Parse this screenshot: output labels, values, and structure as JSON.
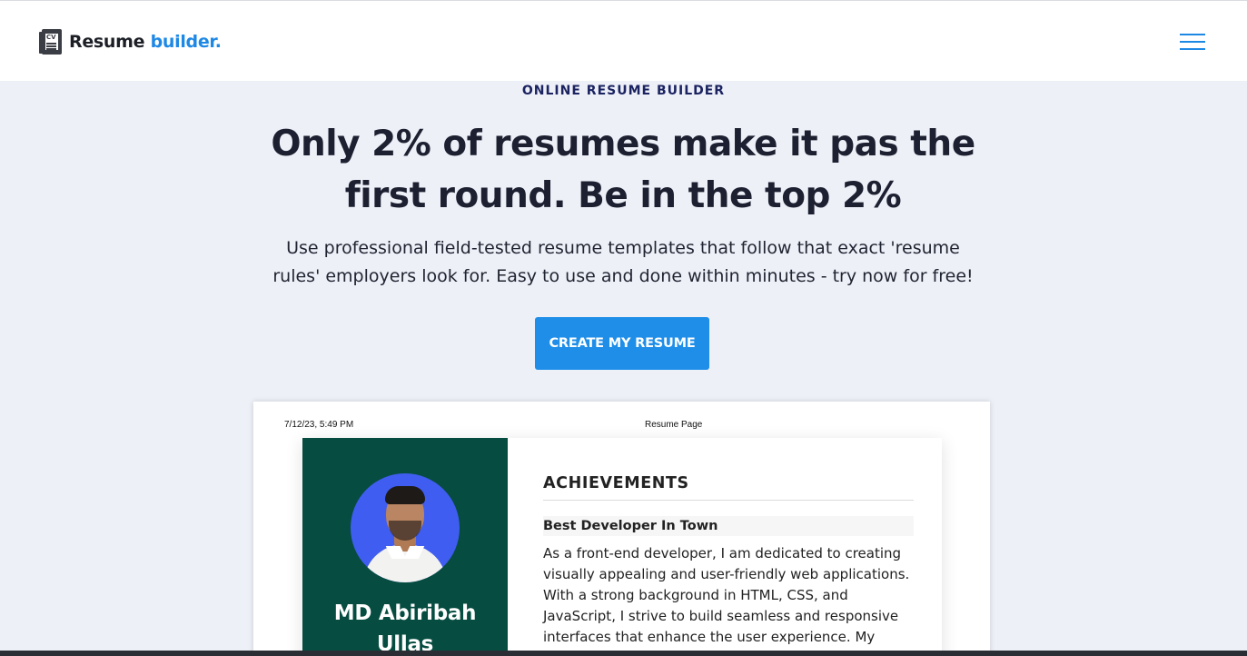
{
  "header": {
    "brand_main": "Resume",
    "brand_accent": "builder.",
    "logo_icon": "cv-document-icon",
    "menu_icon": "hamburger-menu-icon"
  },
  "hero": {
    "eyebrow": "ONLINE RESUME BUILDER",
    "headline_line1": "Only 2% of resumes make it pas the",
    "headline_line2": "first round. Be in the top 2%",
    "subtext_line1": "Use professional field-tested resume templates that follow that exact 'resume",
    "subtext_line2": "rules' employers look for. Easy to use and done within minutes - try now for free!",
    "cta_label": "CREATE MY RESUME"
  },
  "preview": {
    "print_date": "7/12/23, 5:49 PM",
    "print_title": "Resume Page",
    "name_line1": "MD Abiribah",
    "name_line2": "Ullas",
    "section_title": "ACHIEVEMENTS",
    "achievement_title": "Best Developer In Town",
    "achievement_desc_lines": [
      "As a front-end developer, I am dedicated to creating",
      "visually appealing and user-friendly web applications.",
      "With a strong background in HTML, CSS, and",
      "JavaScript, I strive to build seamless and responsive",
      "interfaces that enhance the user experience. My"
    ]
  },
  "colors": {
    "accent": "#1e88e5",
    "cta": "#1e8ee8",
    "page_bg": "#eef0f8",
    "sidebar": "#064c40",
    "avatar_bg": "#3f5df0"
  }
}
